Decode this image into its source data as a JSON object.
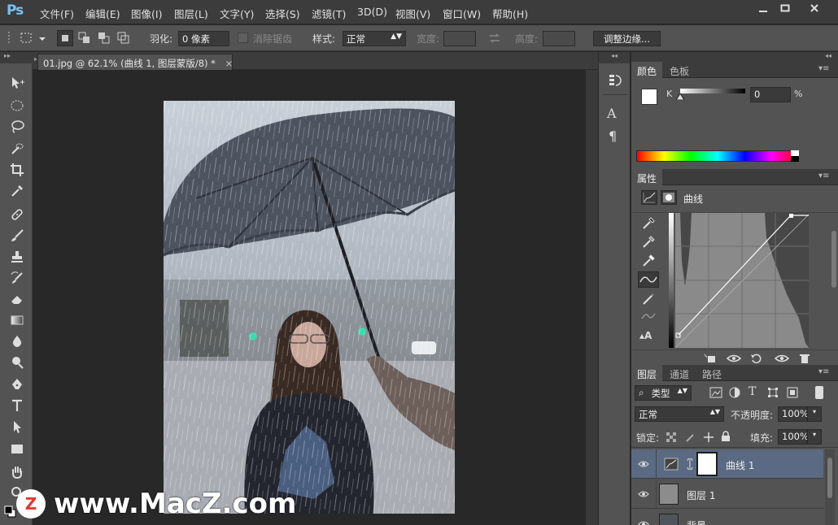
{
  "app": {
    "logo": "Ps"
  },
  "menu": [
    "文件(F)",
    "编辑(E)",
    "图像(I)",
    "图层(L)",
    "文字(Y)",
    "选择(S)",
    "滤镜(T)",
    "3D(D)",
    "视图(V)",
    "窗口(W)",
    "帮助(H)"
  ],
  "options": {
    "feather_label": "羽化:",
    "feather_value": "0 像素",
    "antialias_label": "消除锯齿",
    "style_label": "样式:",
    "style_value": "正常",
    "width_label": "宽度:",
    "height_label": "高度:",
    "refine_button": "调整边缘..."
  },
  "document": {
    "tab_title": "01.jpg @ 62.1% (曲线 1, 图层蒙版/8) *",
    "close": "×"
  },
  "color_panel": {
    "tabs": [
      "颜色",
      "色板"
    ],
    "channel_label": "K",
    "channel_value": "0",
    "unit": "%",
    "slider_level": 0
  },
  "properties_panel": {
    "tab": "属性",
    "title": "曲线"
  },
  "layers_panel": {
    "tabs": [
      "图层",
      "通道",
      "路径"
    ],
    "filter_value": "类型",
    "blend_mode": "正常",
    "opacity_label": "不透明度:",
    "opacity_value": "100%",
    "lock_label": "锁定:",
    "fill_label": "填充:",
    "fill_value": "100%",
    "layers": [
      {
        "name": "曲线 1",
        "selected": true
      },
      {
        "name": "图层 1",
        "selected": false
      },
      {
        "name": "背景",
        "selected": false
      }
    ]
  },
  "watermark": {
    "text": "www.MacZ.com",
    "badge": "Z"
  },
  "colors": {
    "menu_bg": "#3c3c3c",
    "panel_bg": "#535353",
    "canvas_bg": "#282828",
    "selected_layer": "#5a6a82",
    "logo_blue": "#7ac0ee"
  }
}
